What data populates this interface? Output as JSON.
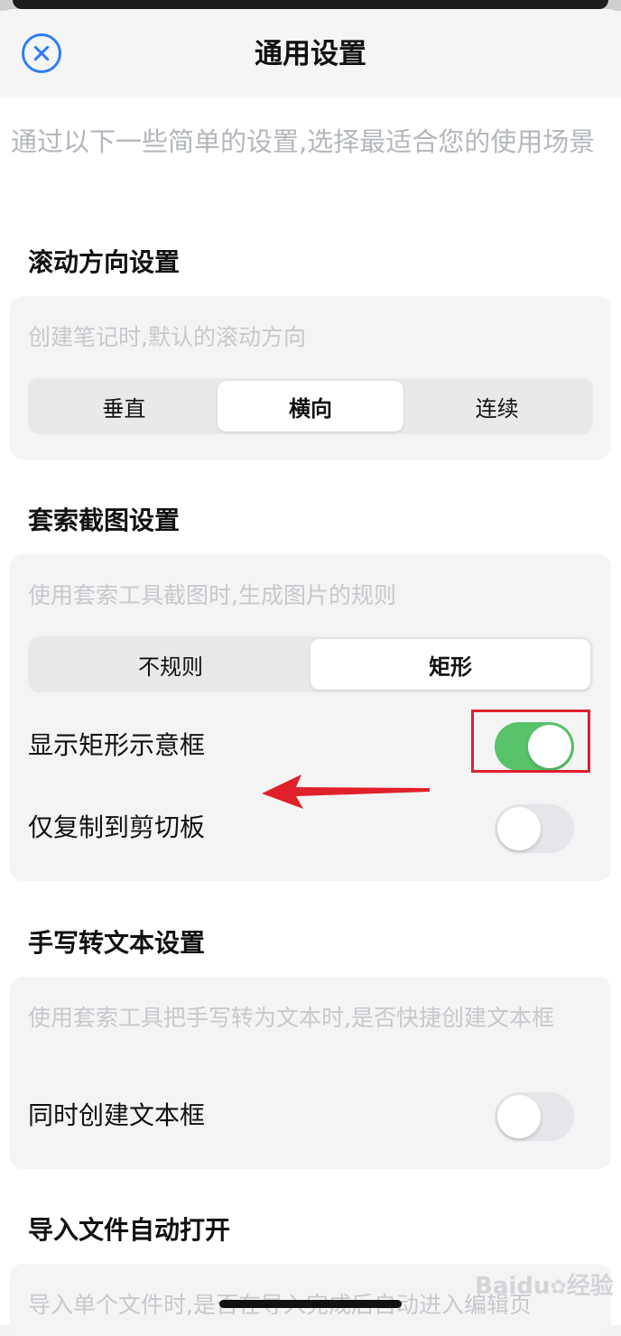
{
  "header": {
    "title": "通用设置",
    "close_icon": "close-circle-icon",
    "accent": "#2f7df6"
  },
  "intro": "通过以下一些简单的设置,选择最适合您的使用场景",
  "scroll": {
    "title": "滚动方向设置",
    "desc": "创建笔记时,默认的滚动方向",
    "options": [
      "垂直",
      "横向",
      "连续"
    ],
    "selected": "横向"
  },
  "lasso": {
    "title": "套索截图设置",
    "desc": "使用套索工具截图时,生成图片的规则",
    "options": [
      "不规则",
      "矩形"
    ],
    "selected": "矩形",
    "rows": [
      {
        "label": "显示矩形示意框",
        "on": true
      },
      {
        "label": "仅复制到剪切板",
        "on": false
      }
    ]
  },
  "handwriting": {
    "title": "手写转文本设置",
    "desc": "使用套索工具把手写转为文本时,是否快捷创建文本框",
    "rows": [
      {
        "label": "同时创建文本框",
        "on": false
      }
    ]
  },
  "import": {
    "title": "导入文件自动打开",
    "desc": "导入单个文件时,是否在导入完成后自动进入编辑页"
  },
  "watermark": {
    "brand": "Baidu",
    "suffix": "经验"
  },
  "colors": {
    "toggle_on": "#58c36b",
    "toggle_off": "#e5e5ea",
    "annotation": "#e0202b"
  }
}
